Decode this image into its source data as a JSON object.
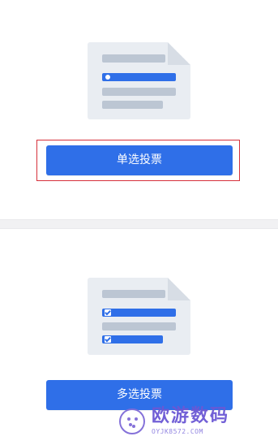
{
  "single_section": {
    "button_label": "单选投票"
  },
  "multi_section": {
    "button_label": "多选投票"
  },
  "watermark": {
    "title": "欧游数码",
    "subtitle": "OYJK8572.COM"
  },
  "colors": {
    "primary_button": "#2f6fe8",
    "highlight_border": "#d6313b",
    "doc_background": "#e9edf2",
    "placeholder_bar": "#bcc6d3",
    "watermark": "#6a57d4"
  },
  "icons": {
    "single_illustration": "single-choice-document-icon",
    "multi_illustration": "multi-choice-document-icon",
    "watermark_logo": "smiley-logo-icon"
  }
}
